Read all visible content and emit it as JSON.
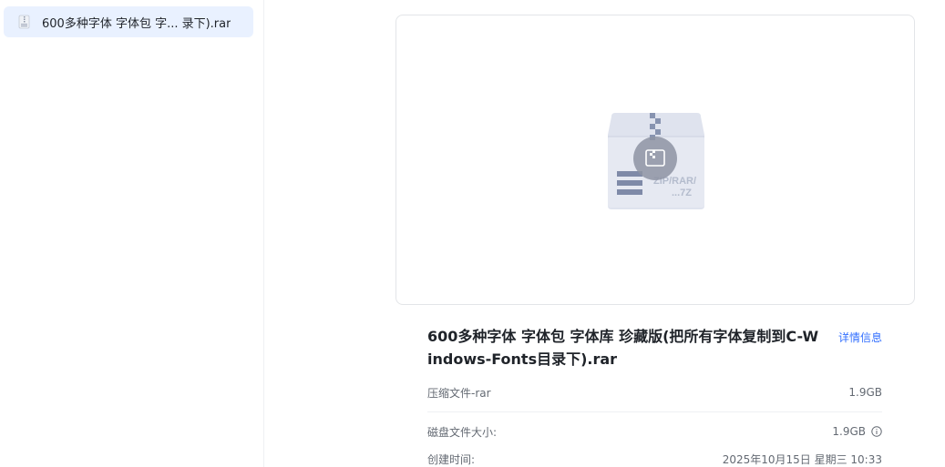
{
  "sidebar": {
    "items": [
      {
        "label": "600多种字体 字体包 字... 录下).rar",
        "icon": "archive-file-icon"
      }
    ]
  },
  "preview": {
    "icon": "archive-zip-icon",
    "icon_text": "ZIP/RAR/\n...7Z"
  },
  "file_info": {
    "title": "600多种字体 字体包 字体库 珍藏版(把所有字体复制到C-Windows-Fonts目录下).rar",
    "details_label": "详情信息",
    "type_label": "压缩文件-rar",
    "type_size": "1.9GB",
    "disk_size_label": "磁盘文件大小:",
    "disk_size_value": "1.9GB",
    "created_label": "创建时间:",
    "created_value": "2025年10月15日 星期三 10:33"
  },
  "colors": {
    "accent": "#3370ff",
    "selected_bg": "#e9f1ff",
    "border": "#e3e5e8"
  }
}
